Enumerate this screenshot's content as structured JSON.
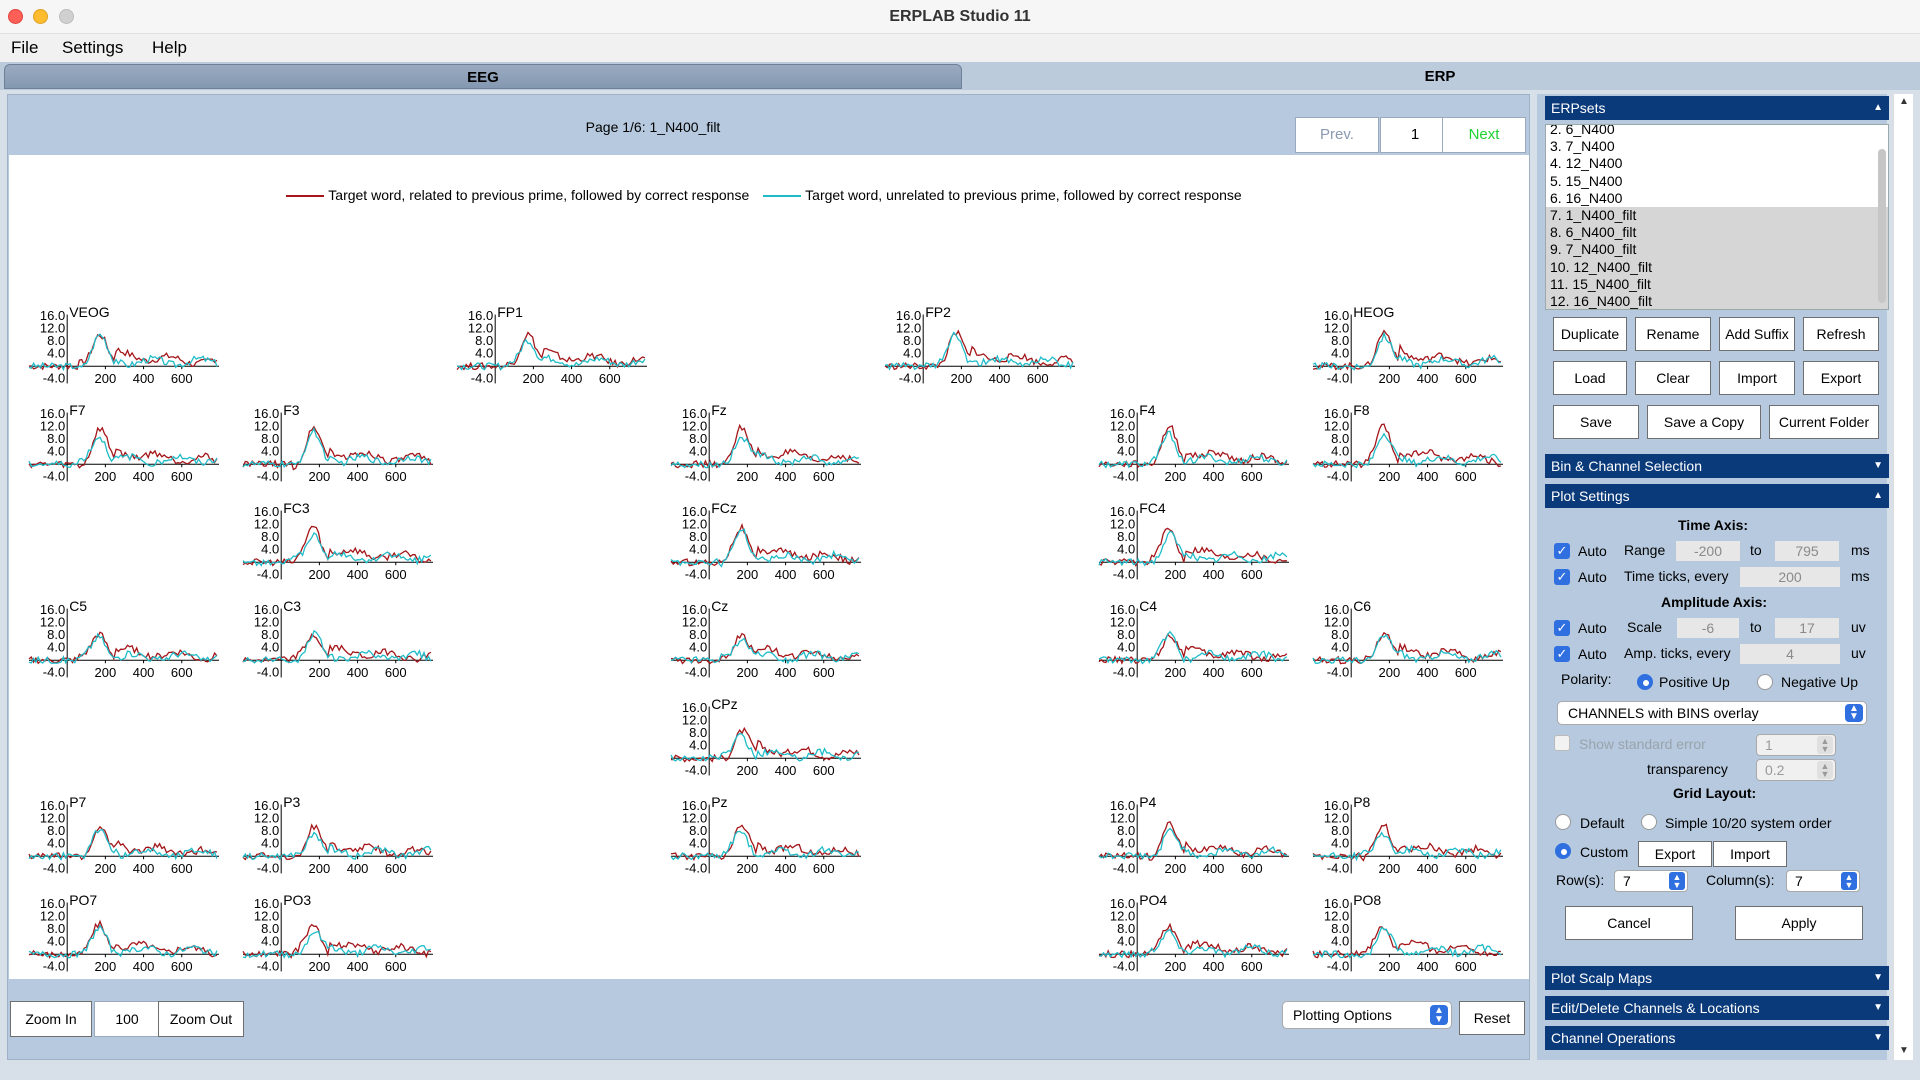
{
  "window": {
    "title": "ERPLAB Studio 11"
  },
  "menu": [
    "File",
    "Settings",
    "Help"
  ],
  "tabs": {
    "eeg": "EEG",
    "erp": "ERP"
  },
  "page": {
    "label": "Page 1/6: 1_N400_filt",
    "prev": "Prev.",
    "page_number": "1",
    "next": "Next"
  },
  "legend": [
    {
      "label": "Target word, related to previous prime, followed by correct response",
      "color": "#a4161a"
    },
    {
      "label": "Target word, unrelated to previous prime, followed by correct response",
      "color": "#1fbcc8"
    }
  ],
  "chart_data": {
    "type": "line",
    "xlabel": "",
    "ylabel": "",
    "x_ticks": [
      "200",
      "400",
      "600"
    ],
    "y_ticks": [
      "16.0",
      "12.0",
      "8.0",
      "4.0",
      "-4.0"
    ],
    "xlim": [
      -200,
      795
    ],
    "ylim": [
      -6,
      17
    ],
    "grid": false,
    "legend_position": "top",
    "series_names": [
      "Target word, related to previous prime, followed by correct response",
      "Target word, unrelated to previous prime, followed by correct response"
    ],
    "channels": [
      "VEOG",
      "FP1",
      "FP2",
      "HEOG",
      "F7",
      "F3",
      "Fz",
      "F4",
      "F8",
      "FC3",
      "FCz",
      "FC4",
      "C5",
      "C3",
      "Cz",
      "C4",
      "C6",
      "CPz",
      "P7",
      "P3",
      "Pz",
      "P4",
      "P8",
      "PO7",
      "PO3",
      "PO4",
      "PO8"
    ]
  },
  "bottom": {
    "zoom_in": "Zoom In",
    "zoom_value": "100",
    "zoom_out": "Zoom Out",
    "plotting_options": "Plotting Options",
    "reset": "Reset"
  },
  "panel": {
    "erpsets_title": "ERPsets",
    "erpsets": [
      {
        "label": "2. 6_N400",
        "selected": false
      },
      {
        "label": "3. 7_N400",
        "selected": false
      },
      {
        "label": "4. 12_N400",
        "selected": false
      },
      {
        "label": "5. 15_N400",
        "selected": false
      },
      {
        "label": "6. 16_N400",
        "selected": false
      },
      {
        "label": "7. 1_N400_filt",
        "selected": true
      },
      {
        "label": "8. 6_N400_filt",
        "selected": true
      },
      {
        "label": "9. 7_N400_filt",
        "selected": true
      },
      {
        "label": "10. 12_N400_filt",
        "selected": true
      },
      {
        "label": "11. 15_N400_filt",
        "selected": true
      },
      {
        "label": "12. 16_N400_filt",
        "selected": true
      }
    ],
    "buttons": {
      "duplicate": "Duplicate",
      "rename": "Rename",
      "add_suffix": "Add Suffix",
      "refresh": "Refresh",
      "load": "Load",
      "clear": "Clear",
      "import": "Import",
      "export": "Export",
      "save": "Save",
      "save_copy": "Save a Copy",
      "current_folder": "Current Folder"
    },
    "bin_channel_title": "Bin & Channel Selection",
    "plot_settings_title": "Plot Settings",
    "time_axis": "Time Axis:",
    "auto": "Auto",
    "range_label": "Range",
    "range_from": "-200",
    "to": "to",
    "range_to": "795",
    "ms": "ms",
    "time_ticks_label": "Time ticks, every",
    "time_ticks_value": "200",
    "amp_axis": "Amplitude Axis:",
    "scale_label": "Scale",
    "scale_from": "-6",
    "scale_to": "17",
    "uv": "uv",
    "amp_ticks_label": "Amp. ticks, every",
    "amp_ticks_value": "4",
    "polarity_label": "Polarity:",
    "positive_up": "Positive Up",
    "negative_up": "Negative Up",
    "overlay_option": "CHANNELS with BINS overlay",
    "show_se": "Show standard error",
    "se_value": "1",
    "transparency_label": "transparency",
    "transparency_value": "0.2",
    "grid_layout": "Grid Layout:",
    "default": "Default",
    "simple_1020": "Simple 10/20 system order",
    "custom": "Custom",
    "grid_export": "Export",
    "grid_import": "Import",
    "rows_label": "Row(s):",
    "rows_value": "7",
    "cols_label": "Column(s):",
    "cols_value": "7",
    "cancel": "Cancel",
    "apply": "Apply",
    "scalp_maps_title": "Plot Scalp Maps",
    "edit_channels_title": "Edit/Delete Channels & Locations",
    "channel_ops_title": "Channel Operations"
  }
}
